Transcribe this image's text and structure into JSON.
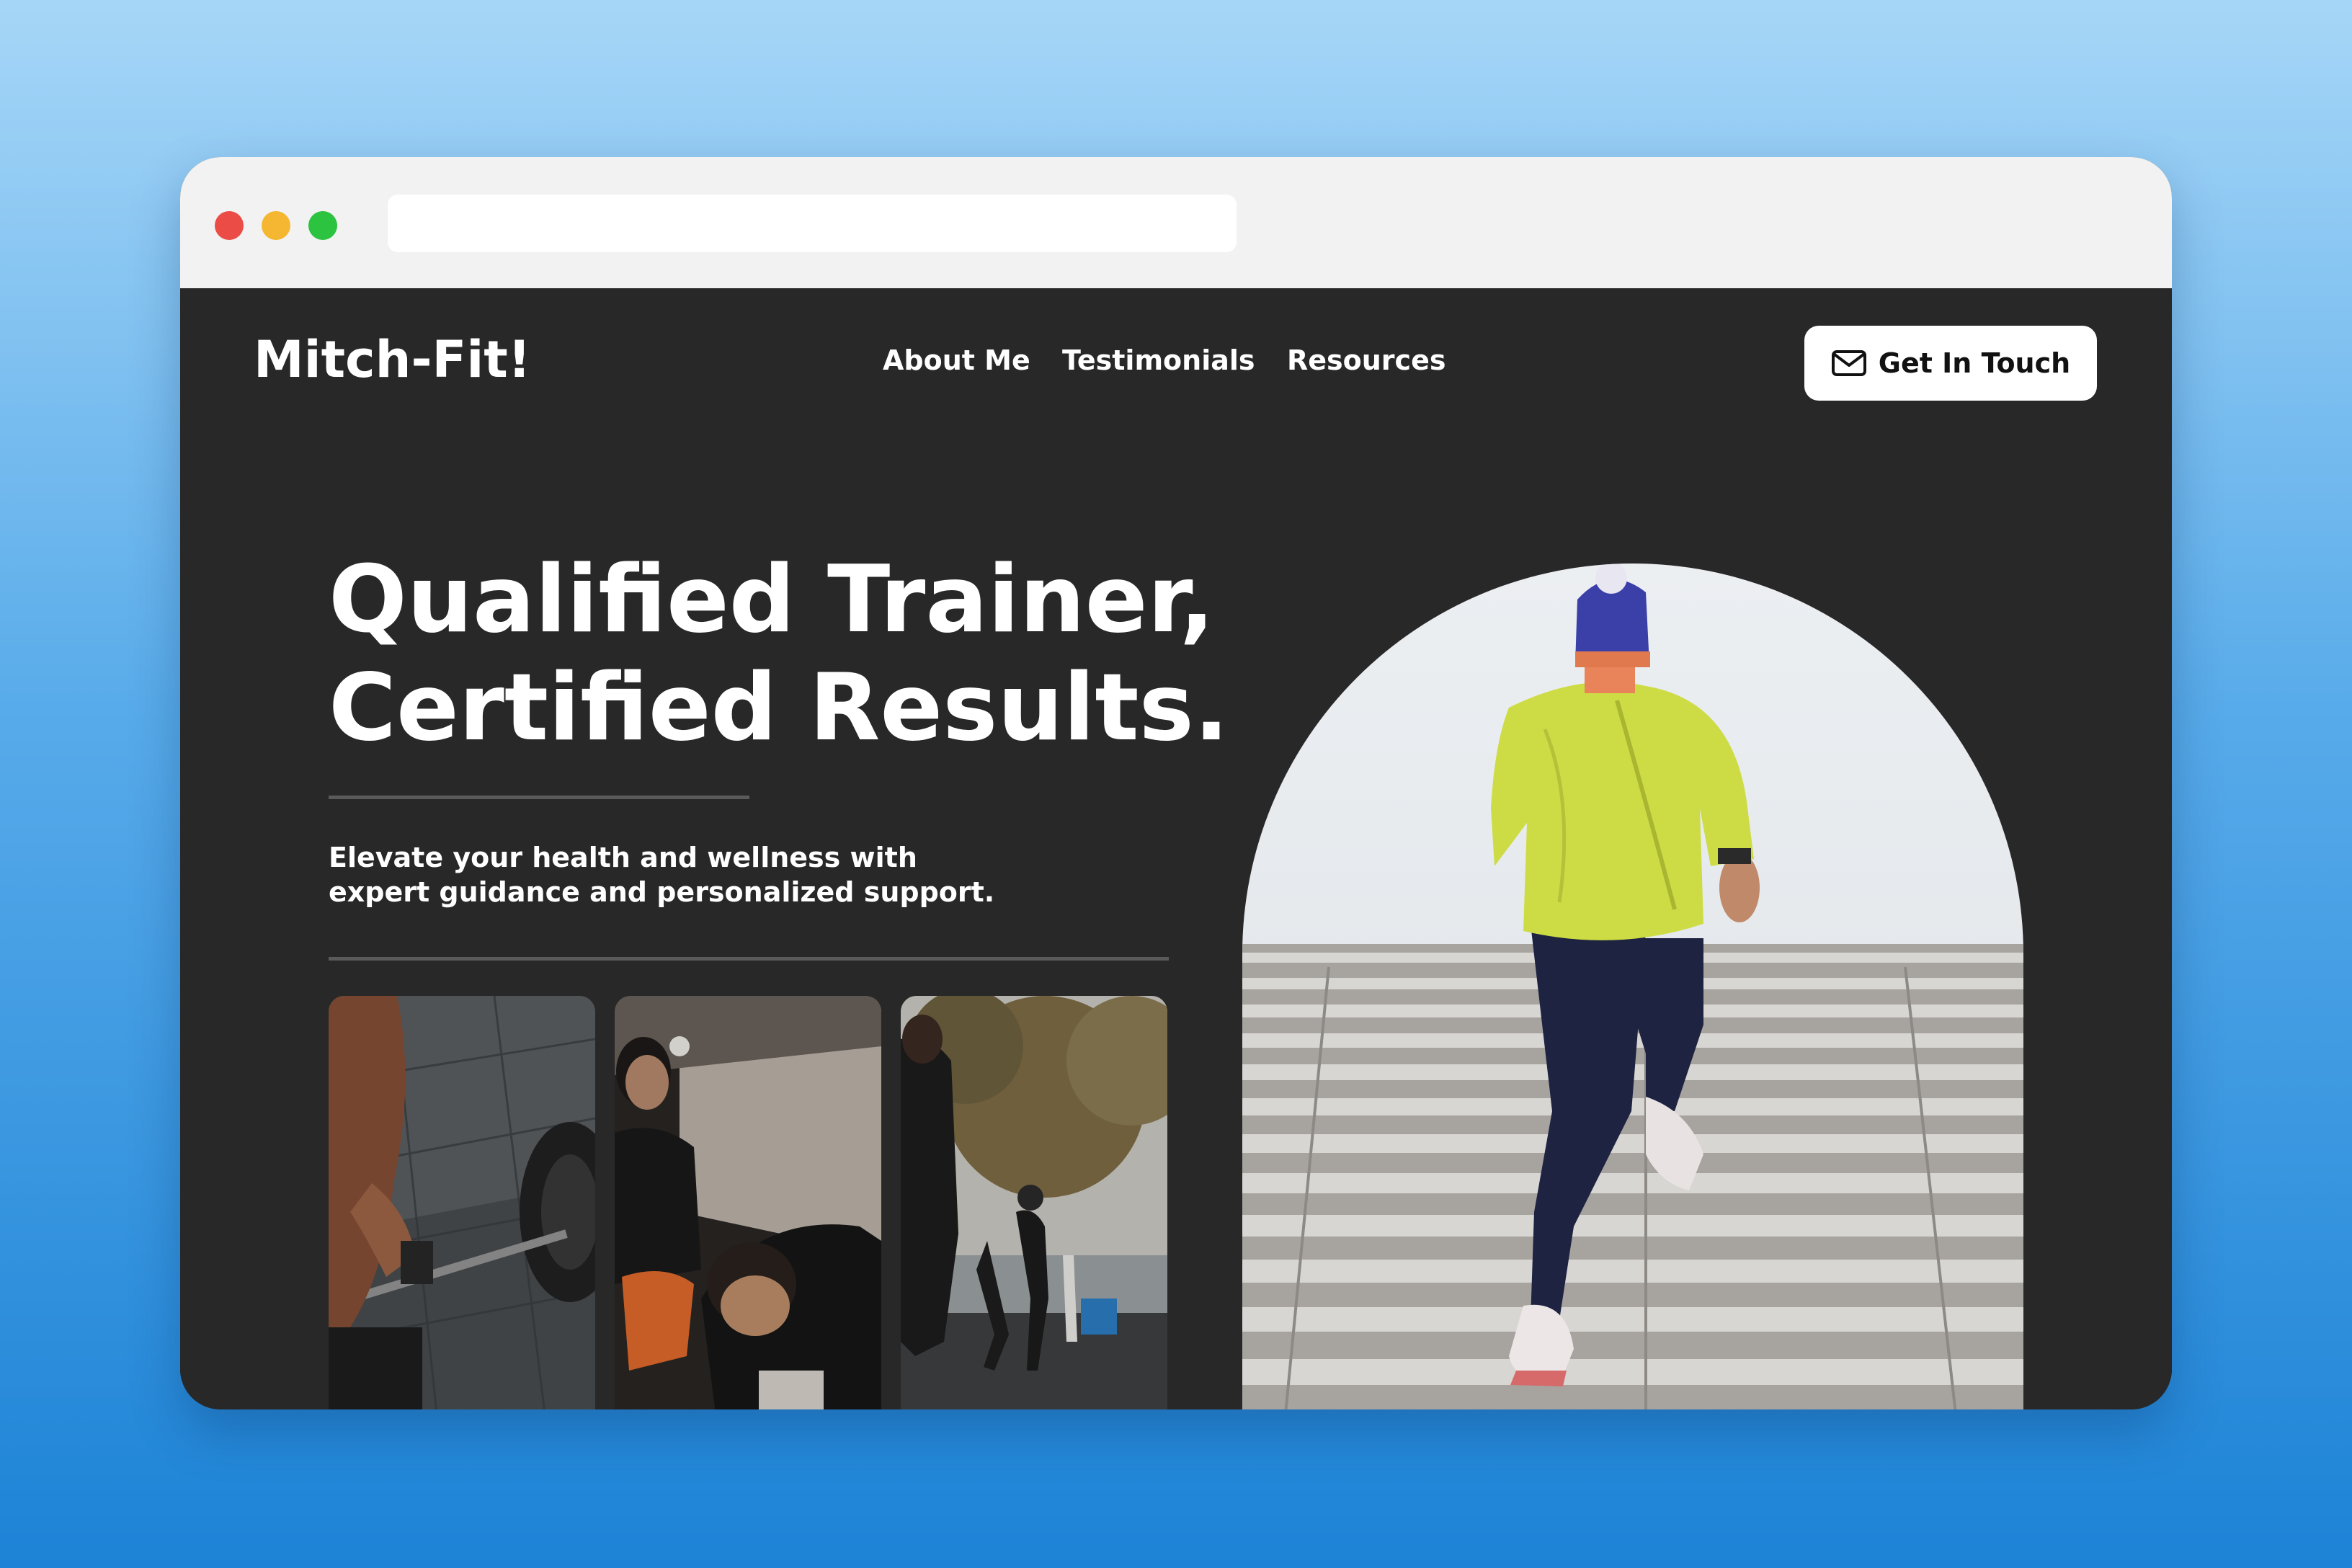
{
  "site": {
    "logo": "Mitch-Fit!",
    "nav": [
      {
        "label": "About Me"
      },
      {
        "label": "Testimonials"
      },
      {
        "label": "Resources"
      }
    ],
    "cta": {
      "label": "Get In Touch",
      "icon": "mail-icon"
    }
  },
  "hero": {
    "headline_line1": "Qualified Trainer,",
    "headline_line2": "Certified Results.",
    "subtext_line1": "Elevate your health and wellness with",
    "subtext_line2": "expert guidance and personalized support."
  },
  "colors": {
    "page_background": "#282828",
    "text": "#ffffff",
    "cta_background": "#ffffff"
  }
}
